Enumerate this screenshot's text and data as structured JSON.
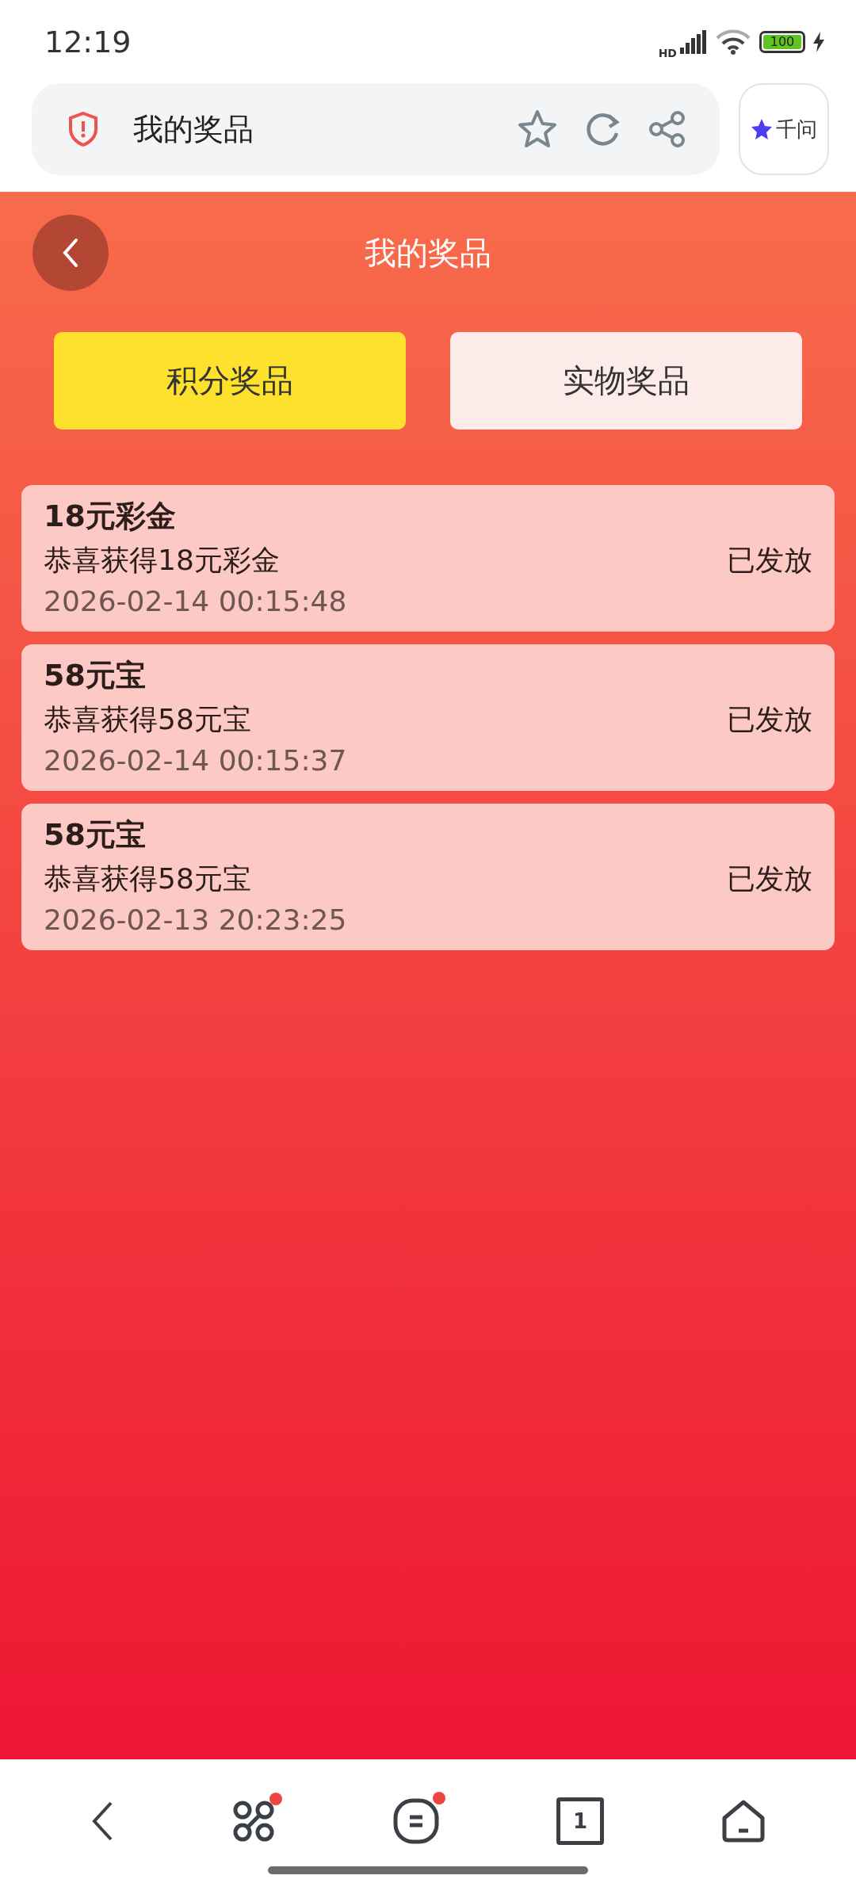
{
  "status_bar": {
    "time": "12:19",
    "network": "HD",
    "battery": "100"
  },
  "browser_bar": {
    "title": "我的奖品",
    "assistant": "千问"
  },
  "header": {
    "title": "我的奖品"
  },
  "tabs": [
    {
      "label": "积分奖品",
      "selected": true
    },
    {
      "label": "实物奖品",
      "selected": false
    }
  ],
  "prizes": [
    {
      "name": "18元彩金",
      "description": "恭喜获得18元彩金",
      "date": "2026-02-14 00:15:48",
      "status": "已发放"
    },
    {
      "name": "58元宝",
      "description": "恭喜获得58元宝",
      "date": "2026-02-14 00:15:37",
      "status": "已发放"
    },
    {
      "name": "58元宝",
      "description": "恭喜获得58元宝",
      "date": "2026-02-13 20:23:25",
      "status": "已发放"
    }
  ],
  "bottom_nav": {
    "tab_count": "1",
    "notifications": [
      true,
      true
    ]
  }
}
